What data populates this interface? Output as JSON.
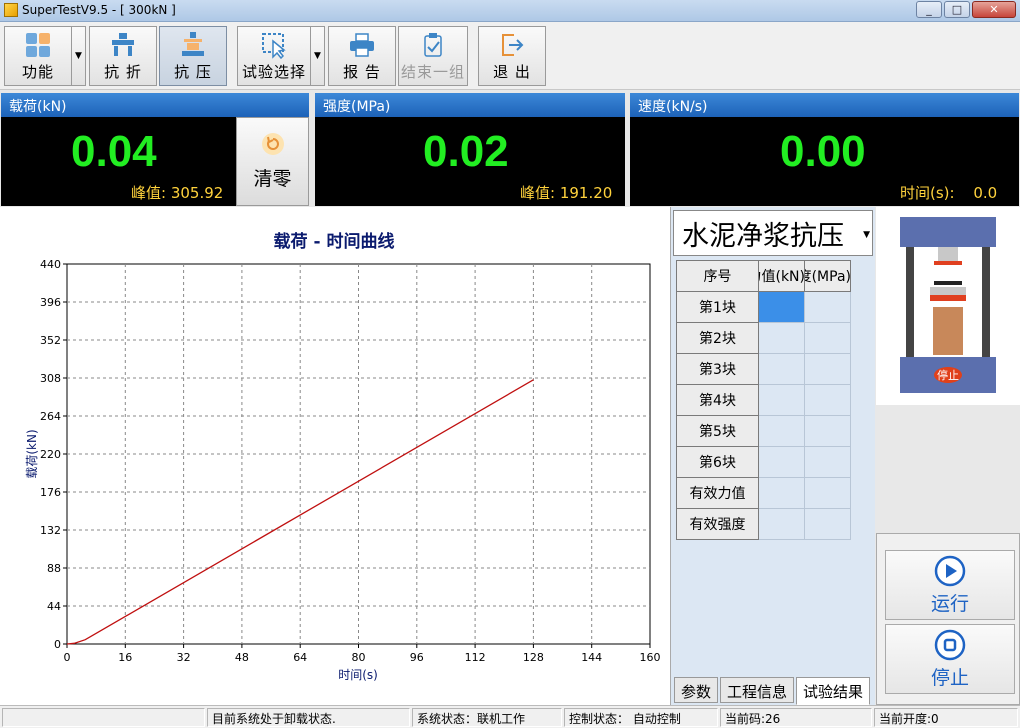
{
  "window": {
    "title": "SuperTestV9.5 - [ 300kN ]",
    "minimize": "_",
    "maximize": "□",
    "close": "✕"
  },
  "toolbar": {
    "function_label": "功能",
    "flexural_label": "抗 折",
    "compression_label": "抗 压",
    "test_select_label": "试验选择",
    "report_label": "报 告",
    "end_group_label": "结束一组",
    "exit_label": "退 出"
  },
  "readouts": {
    "load": {
      "header": "载荷(kN)",
      "value": "0.04",
      "peak_label": "峰值:",
      "peak_value": "305.92"
    },
    "strength": {
      "header": "强度(MPa)",
      "value": "0.02",
      "peak_label": "峰值:",
      "peak_value": "191.20"
    },
    "speed": {
      "header": "速度(kN/s)",
      "value": "0.00",
      "time_label": "时间(s):",
      "time_value": "0.0"
    },
    "zero_label": "清零"
  },
  "chart_data": {
    "type": "line",
    "title": "载荷 - 时间曲线",
    "xlabel": "时间(s)",
    "ylabel": "载荷(kN)",
    "xlim": [
      0,
      160
    ],
    "ylim": [
      0,
      440
    ],
    "xticks": [
      0,
      16,
      32,
      48,
      64,
      80,
      96,
      112,
      128,
      144,
      160
    ],
    "yticks": [
      0,
      44,
      88,
      132,
      176,
      220,
      264,
      308,
      352,
      396,
      440
    ],
    "grid": true,
    "series": [
      {
        "color": "#c01010",
        "x": [
          0,
          2,
          5,
          128
        ],
        "y": [
          0,
          0.8,
          5,
          305.92
        ]
      }
    ]
  },
  "panel": {
    "test_type": "水泥净浆抗压",
    "columns": [
      "序号",
      "力值(kN)",
      "强度(MPa)"
    ],
    "rows": [
      "第1块",
      "第2块",
      "第3块",
      "第4块",
      "第5块",
      "第6块",
      "有效力值",
      "有效强度"
    ],
    "tabs": [
      "参数",
      "工程信息",
      "试验结果"
    ]
  },
  "machine": {
    "status": "停止"
  },
  "controls": {
    "run_label": "运行",
    "stop_label": "停止"
  },
  "statusbar": {
    "s1": "",
    "s2": "目前系统处于卸载状态.",
    "s3": "系统状态：联机工作",
    "s4": "控制状态：  自动控制",
    "s5": "当前码:26",
    "s6": "当前开度:0"
  },
  "colors": {
    "accent": "#1e63c4",
    "digits": "#22ee22",
    "peak": "#ffd23c",
    "curve": "#c01010"
  }
}
